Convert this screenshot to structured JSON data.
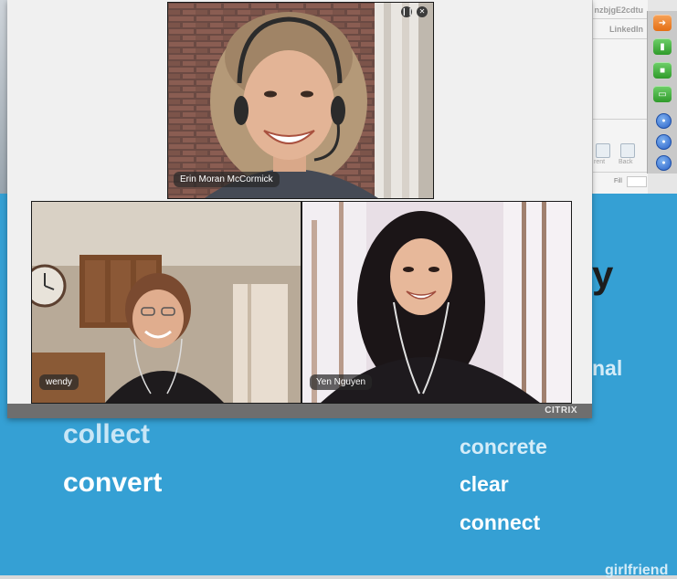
{
  "background_browser": {
    "tab_text_1": "nzbjgE2cdtu",
    "tab_text_2": "LinkedIn",
    "mini_label_1": "rent",
    "mini_label_2": "Back",
    "fill_label": "Fill"
  },
  "toolbar": {
    "buttons": [
      {
        "name": "collapse-arrow",
        "color": "#e56f14"
      },
      {
        "name": "microphone",
        "color": "#2f9a2a"
      },
      {
        "name": "webcam",
        "color": "#2f9a2a"
      },
      {
        "name": "screen-share",
        "color": "#2f9a2a"
      },
      {
        "name": "circle-1",
        "color": "#2a62c8"
      },
      {
        "name": "circle-2",
        "color": "#2a62c8"
      },
      {
        "name": "circle-3",
        "color": "#2a62c8"
      }
    ]
  },
  "video_window": {
    "brand": "CITRIX",
    "participants": [
      {
        "id": "top",
        "name": "Erin Moran McCormick"
      },
      {
        "id": "left",
        "name": "wendy"
      },
      {
        "id": "right",
        "name": "Yen Nguyen"
      }
    ],
    "controls": {
      "pause_icon": "pause-icon",
      "close_icon": "close-icon"
    }
  },
  "slide": {
    "background_color": "#35a0d4",
    "words_left": [
      "collect",
      "convert"
    ],
    "words_right": [
      "concrete",
      "clear",
      "connect"
    ],
    "partial_y": "y",
    "partial_nal": "nal",
    "partial_footer": "girlfriend"
  }
}
